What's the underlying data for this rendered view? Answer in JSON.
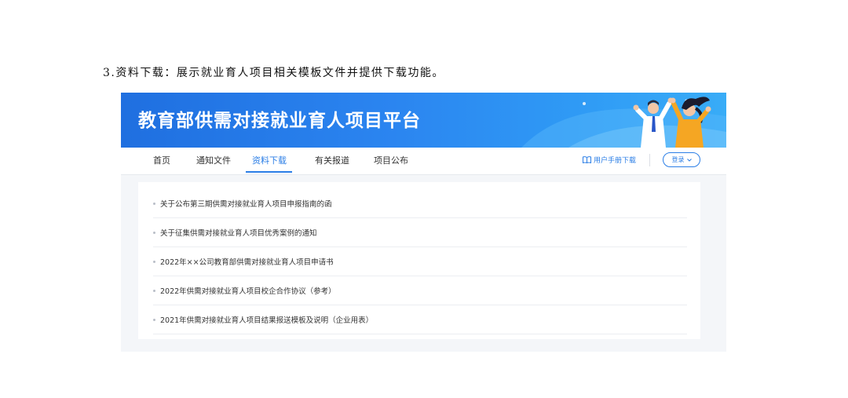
{
  "caption": "3.资料下载：展示就业育人项目相关模板文件并提供下载功能。",
  "banner": {
    "title": "教育部供需对接就业育人项目平台"
  },
  "nav": {
    "items": [
      {
        "label": "首页"
      },
      {
        "label": "通知文件"
      },
      {
        "label": "资料下载",
        "active": true
      },
      {
        "label": "有关报道"
      },
      {
        "label": "项目公布"
      }
    ],
    "manual_label": "用户手册下载",
    "login_label": "登录"
  },
  "downloads": [
    {
      "title": "关于公布第三期供需对接就业育人项目申报指南的函"
    },
    {
      "title": "关于征集供需对接就业育人项目优秀案例的通知"
    },
    {
      "title": "2022年××公司教育部供需对接就业育人项目申请书"
    },
    {
      "title": "2022年供需对接就业育人项目校企合作协议（参考）"
    },
    {
      "title": "2021年供需对接就业育人项目结果报送模板及说明（企业用表）"
    }
  ],
  "colors": {
    "accent": "#2b7ee6",
    "banner_start": "#1f6fe0",
    "banner_end": "#38acf7"
  }
}
